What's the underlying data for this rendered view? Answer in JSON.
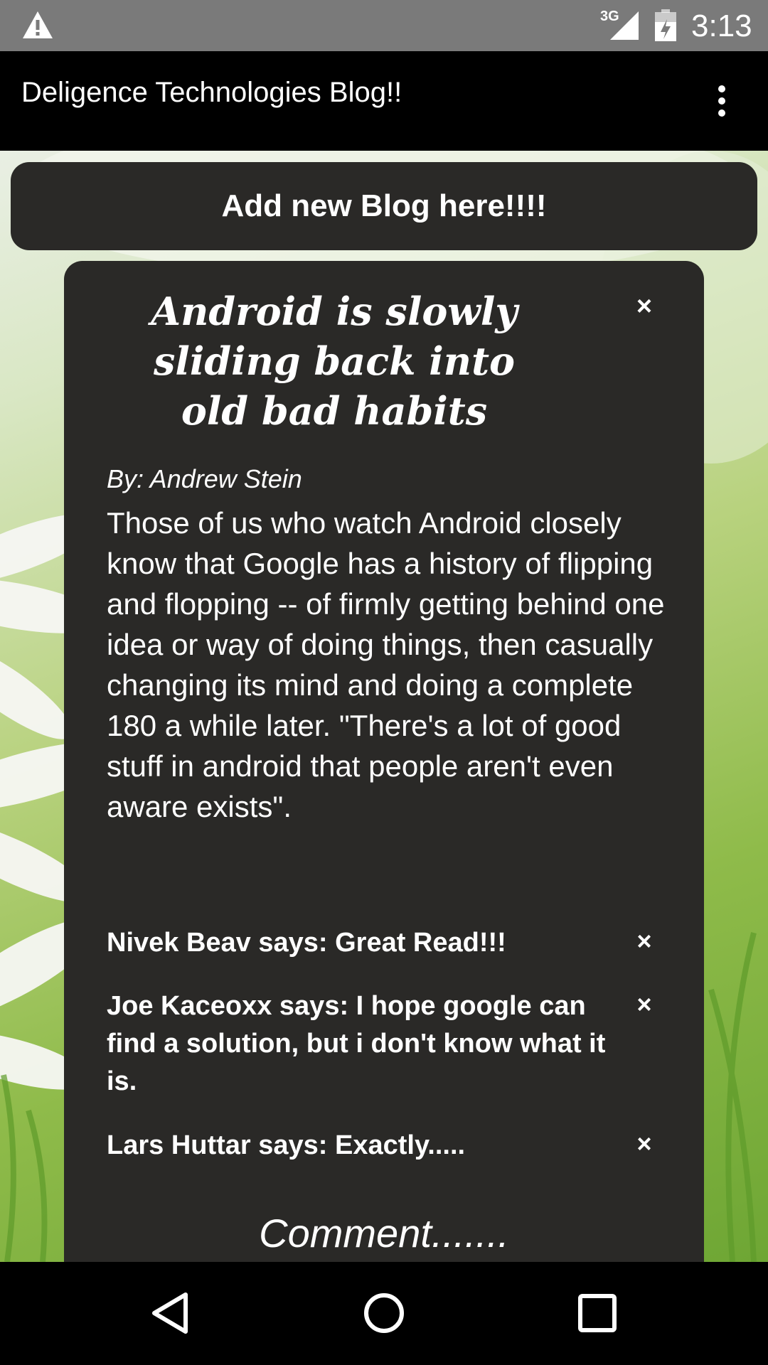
{
  "status_bar": {
    "time": "3:13",
    "network_label": "3G",
    "icons": [
      "warning-icon",
      "signal-icon",
      "battery-icon"
    ]
  },
  "app_bar": {
    "title": "Deligence Technologies Blog!!",
    "menu_icon": "more-vert-icon"
  },
  "add_blog": {
    "label": "Add new Blog here!!!!"
  },
  "blog": {
    "title": "Android is slowly sliding back into old bad habits",
    "close_symbol": "×",
    "author": "By: Andrew Stein",
    "body": "Those of us who watch Android closely know that Google has a history of flipping and flopping -- of firmly getting behind one idea or way of doing things, then casually changing its mind and doing a complete 180 a while later. \"There's a lot of good stuff in android that people aren't even aware exists\".",
    "comments": [
      {
        "text": "Nivek Beav says: Great Read!!!",
        "close_symbol": "×"
      },
      {
        "text": "Joe Kaceoxx says: I hope google can find a solution, but i don't know what it is.",
        "close_symbol": "×"
      },
      {
        "text": "Lars Huttar says: Exactly.....",
        "close_symbol": "×"
      }
    ],
    "comment_placeholder": "Comment......."
  },
  "nav_bar": {
    "icons": [
      "back-icon",
      "home-icon",
      "recents-icon"
    ]
  },
  "colors": {
    "status_bar": "#7a7a7a",
    "app_bar": "#000000",
    "card": "#2a2927",
    "text": "#ffffff"
  }
}
